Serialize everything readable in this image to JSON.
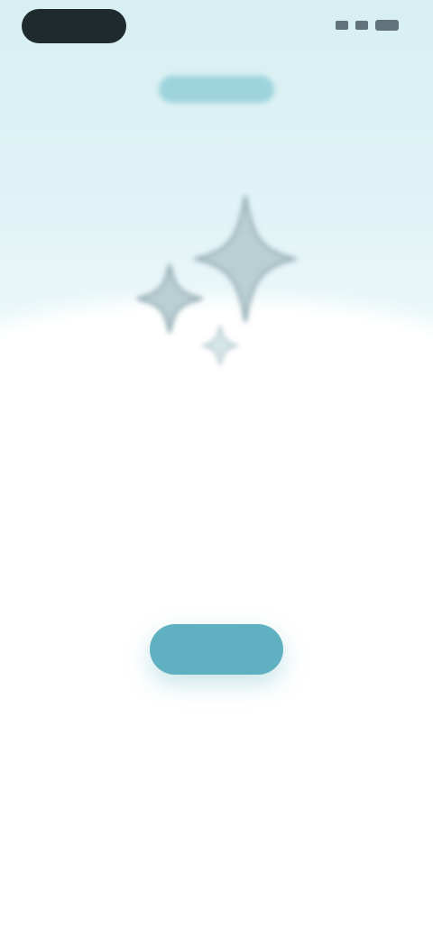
{
  "colors": {
    "background": "#ffffff",
    "top_gradient": "#d7eff2",
    "accent": "#5fb1c1",
    "header_pill": "#9dd3dc",
    "sparkle": "#8fa9b0",
    "title": "#34474d",
    "subtitle": "#7c8b90",
    "status_pill": "#1f2a2d"
  },
  "status_bar": {
    "icons": [
      "signal-icon",
      "wifi-icon",
      "battery-icon"
    ]
  },
  "header": {
    "pill_label": ""
  },
  "hero": {
    "icon": "sparkles-icon"
  },
  "content": {
    "title": "",
    "subtitle": ""
  },
  "cta": {
    "label": ""
  }
}
